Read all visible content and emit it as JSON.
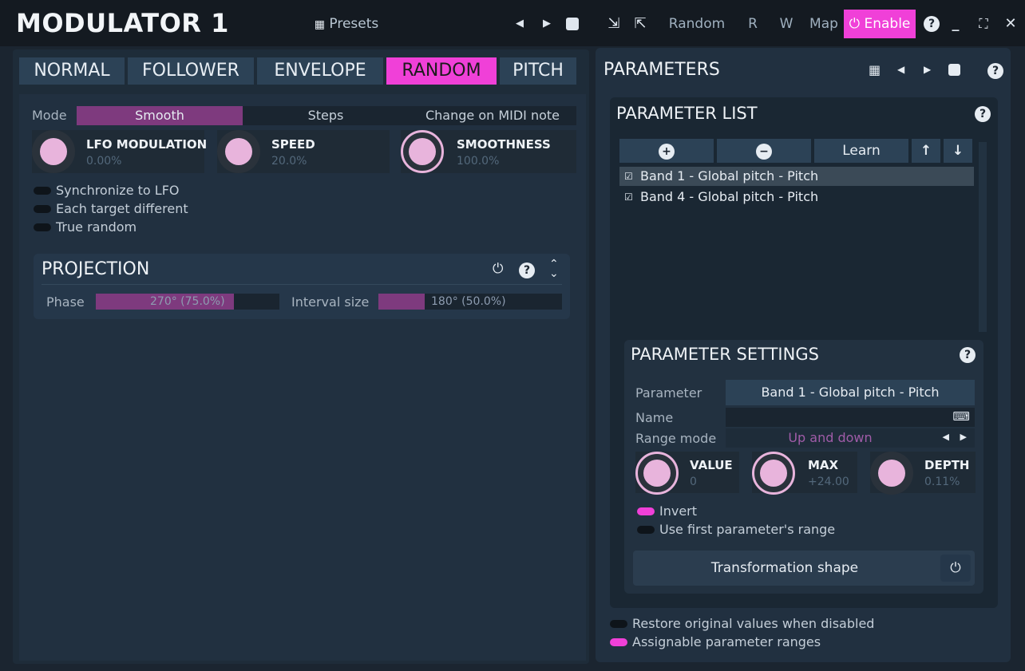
{
  "window": {
    "title": "MODULATOR 1",
    "presets_label": "Presets",
    "random_label": "Random",
    "r_label": "R",
    "w_label": "W",
    "map_label": "Map",
    "enable_label": "Enable",
    "help_icon": "?",
    "prev_icon": "◀",
    "next_icon": "▶",
    "minimize_icon": "_",
    "close_icon": "✕"
  },
  "tabs": [
    {
      "label": "NORMAL"
    },
    {
      "label": "FOLLOWER"
    },
    {
      "label": "ENVELOPE"
    },
    {
      "label": "RANDOM"
    },
    {
      "label": "PITCH"
    }
  ],
  "random_tab": {
    "mode_label": "Mode",
    "modes": [
      "Smooth",
      "Steps",
      "Change on MIDI note"
    ],
    "selected_mode": "Smooth",
    "knobs": [
      {
        "name": "LFO MODULATION",
        "value": "0.00%"
      },
      {
        "name": "SPEED",
        "value": "20.0%"
      },
      {
        "name": "SMOOTHNESS",
        "value": "100.0%"
      }
    ],
    "toggles": [
      {
        "label": "Synchronize to LFO",
        "on": false
      },
      {
        "label": "Each target different",
        "on": false
      },
      {
        "label": "True random",
        "on": false
      }
    ]
  },
  "projection": {
    "title": "PROJECTION",
    "phase_label": "Phase",
    "phase_value": "270° (75.0%)",
    "phase_fraction": 0.75,
    "interval_label": "Interval size",
    "interval_value": "180° (50.0%)",
    "interval_fraction": 0.5
  },
  "parameters": {
    "title": "PARAMETERS",
    "list": {
      "title": "PARAMETER LIST",
      "add_icon": "+",
      "remove_icon": "−",
      "learn_label": "Learn",
      "up_icon": "↑",
      "down_icon": "↓",
      "items": [
        {
          "label": "Band 1 - Global pitch - Pitch",
          "checked": true
        },
        {
          "label": "Band 4 - Global pitch - Pitch",
          "checked": true
        }
      ]
    },
    "settings": {
      "title": "PARAMETER SETTINGS",
      "parameter_label": "Parameter",
      "parameter_value": "Band 1 - Global pitch - Pitch",
      "name_label": "Name",
      "name_value": "",
      "range_mode_label": "Range mode",
      "range_mode_value": "Up and down",
      "knobs": [
        {
          "name": "VALUE",
          "value": "0"
        },
        {
          "name": "MAX",
          "value": "+24.00"
        },
        {
          "name": "DEPTH",
          "value": "0.11%"
        }
      ],
      "invert_label": "Invert",
      "invert_on": true,
      "first_range_label": "Use first parameter's range",
      "first_range_on": false,
      "transformation_label": "Transformation shape"
    },
    "restore_label": "Restore original values when disabled",
    "restore_on": false,
    "assignable_label": "Assignable parameter ranges",
    "assignable_on": true
  },
  "colors": {
    "accent": "#f040d8",
    "knob": "#e8b4dc",
    "panel": "#213040"
  }
}
